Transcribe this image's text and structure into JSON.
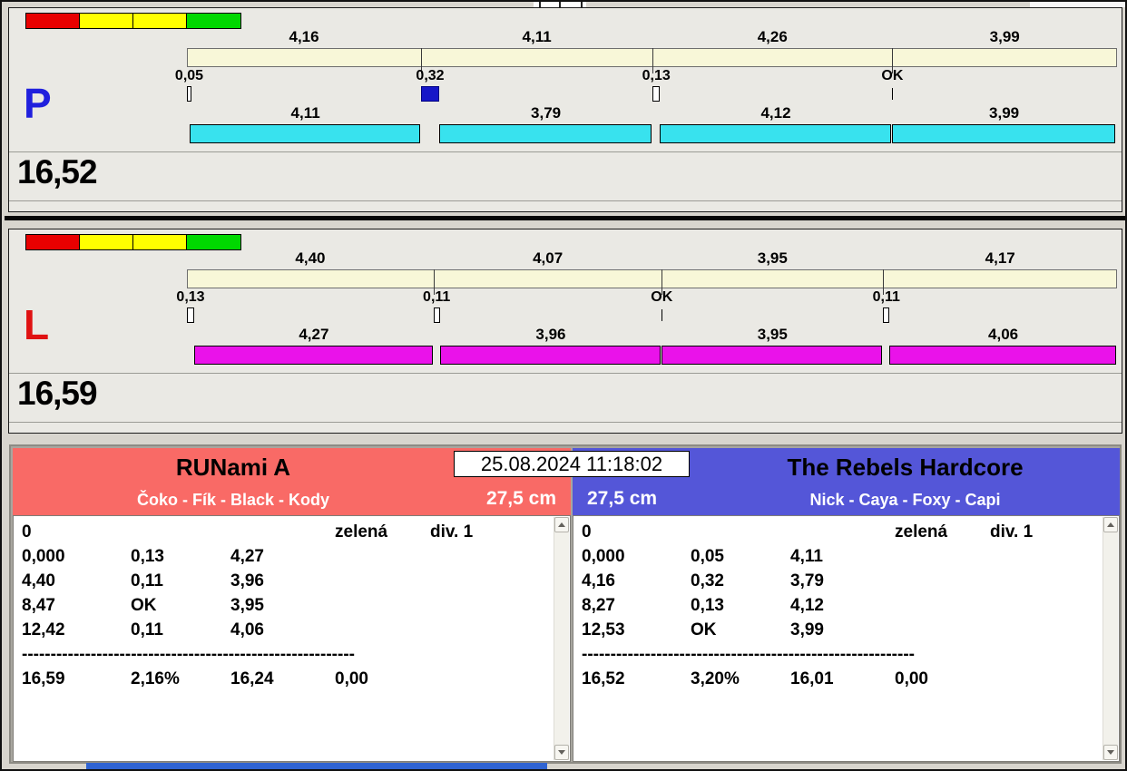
{
  "meta": {
    "datetime": "25.08.2024 11:18:02"
  },
  "colors": {
    "window_bg": "#d8d5ce",
    "panel_bg": "#eae9e4",
    "track_bg": "#f8f7d8",
    "marker_blue": "#1616c8",
    "taskbar_blue": "#2f63d2"
  },
  "status_lights": [
    "#e80000",
    "#ffff00",
    "#ffff00",
    "#00d800"
  ],
  "lanes": [
    {
      "letter": "P",
      "letter_color": "#2020dd",
      "total": "16,52",
      "bar_color": "#38e2ee",
      "legs_top": [
        "4,16",
        "4,11",
        "4,26",
        "3,99"
      ],
      "splits": [
        {
          "value": "0,05",
          "style": "outline"
        },
        {
          "value": "0,32",
          "style": "filled"
        },
        {
          "value": "0,13",
          "style": "outline"
        },
        {
          "value": "OK",
          "style": "tick"
        }
      ],
      "legs_bottom": [
        "4,11",
        "3,79",
        "4,12",
        "3,99"
      ]
    },
    {
      "letter": "L",
      "letter_color": "#e01212",
      "total": "16,59",
      "bar_color": "#ea12ea",
      "legs_top": [
        "4,40",
        "4,07",
        "3,95",
        "4,17"
      ],
      "splits": [
        {
          "value": "0,13",
          "style": "outline"
        },
        {
          "value": "0,11",
          "style": "outline"
        },
        {
          "value": "OK",
          "style": "tick"
        },
        {
          "value": "0,11",
          "style": "outline"
        }
      ],
      "legs_bottom": [
        "4,27",
        "3,96",
        "3,95",
        "4,06"
      ]
    }
  ],
  "teams": [
    {
      "name": "RUNami A",
      "dogs": "Čoko - Fík - Black - Kody",
      "jump_height": "27,5 cm",
      "header_bg": "#f96a66",
      "rows": [
        {
          "cells": [
            "0",
            "",
            "",
            "zelená",
            "div. 1"
          ]
        },
        {
          "cells": [
            "0,000",
            "0,13",
            "4,27",
            "",
            ""
          ]
        },
        {
          "cells": [
            "4,40",
            "0,11",
            "3,96",
            "",
            ""
          ]
        },
        {
          "cells": [
            "8,47",
            "OK",
            "3,95",
            "",
            ""
          ]
        },
        {
          "cells": [
            "12,42",
            "0,11",
            "4,06",
            "",
            ""
          ]
        },
        {
          "divider": "----------------------------------------------------------"
        },
        {
          "cells": [
            "16,59",
            "2,16%",
            "16,24",
            "0,00",
            ""
          ]
        }
      ]
    },
    {
      "name": "The Rebels Hardcore",
      "dogs": "Nick - Caya - Foxy - Capi",
      "jump_height": "27,5 cm",
      "header_bg": "#5456d8",
      "rows": [
        {
          "cells": [
            "0",
            "",
            "",
            "zelená",
            "div. 1"
          ]
        },
        {
          "cells": [
            "0,000",
            "0,05",
            "4,11",
            "",
            ""
          ]
        },
        {
          "cells": [
            "4,16",
            "0,32",
            "3,79",
            "",
            ""
          ]
        },
        {
          "cells": [
            "8,27",
            "0,13",
            "4,12",
            "",
            ""
          ]
        },
        {
          "cells": [
            "12,53",
            "OK",
            "3,99",
            "",
            ""
          ]
        },
        {
          "divider": "----------------------------------------------------------"
        },
        {
          "cells": [
            "16,52",
            "3,20%",
            "16,01",
            "0,00",
            ""
          ]
        }
      ]
    }
  ]
}
